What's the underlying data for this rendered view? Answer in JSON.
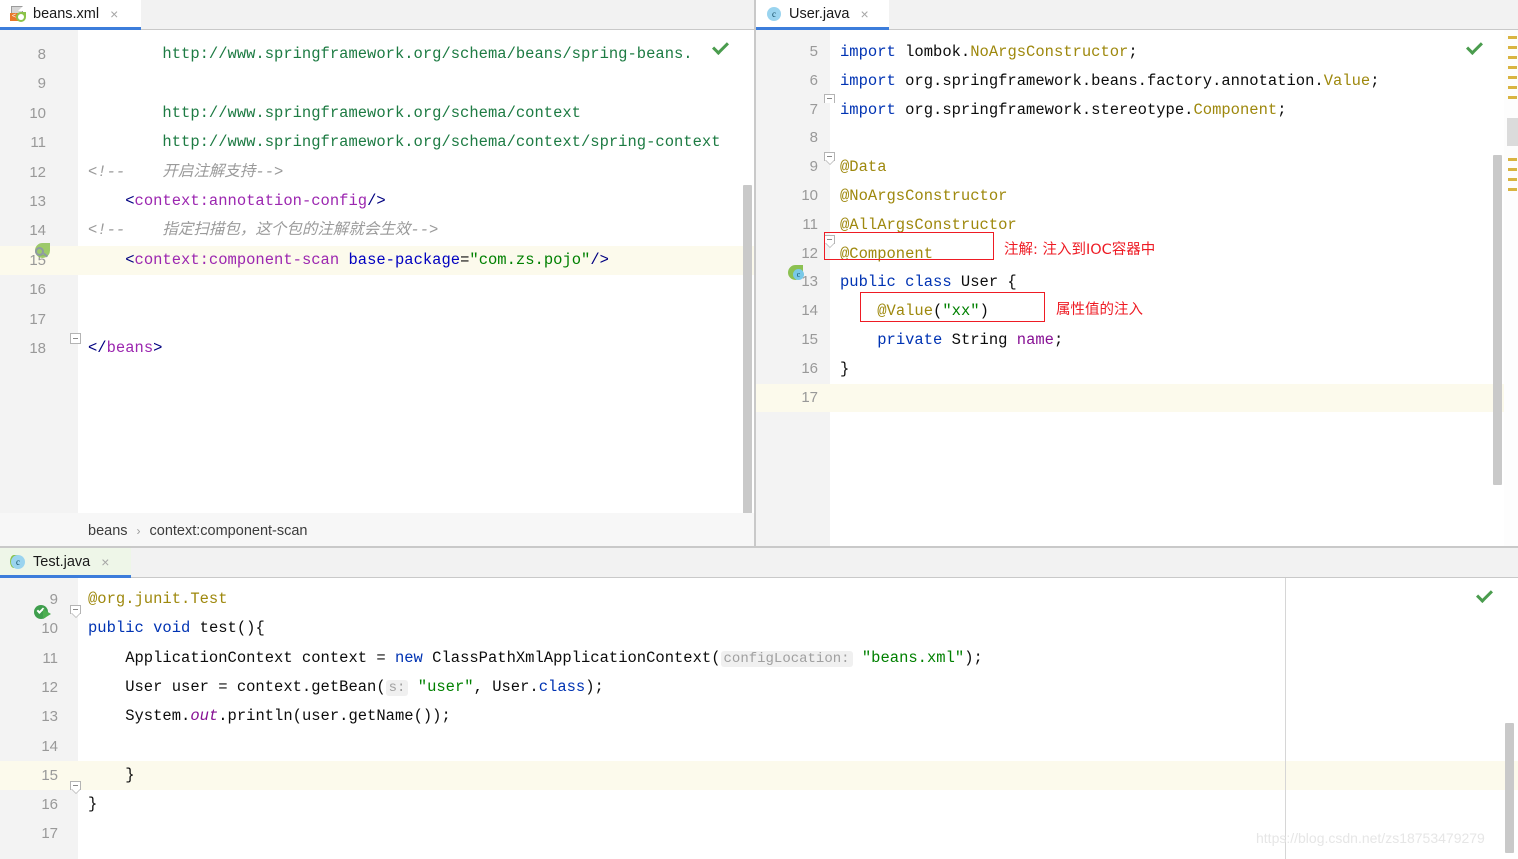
{
  "window": {
    "watermark": "https://blog.csdn.net/zs18753479279"
  },
  "panes": {
    "xml": {
      "tab": {
        "label": "beans.xml",
        "close": "×",
        "icon": "xml-file-icon",
        "icon_letter": "<"
      },
      "breadcrumb": {
        "root": "beans",
        "sep": "›",
        "leaf": "context:component-scan"
      },
      "lines": [
        {
          "num": "8",
          "indent": 0,
          "tokens": [
            {
              "t": "url",
              "v": "        http://www.springframework.org/schema/beans/spring-beans."
            }
          ]
        },
        {
          "num": "9",
          "indent": 0,
          "tokens": []
        },
        {
          "num": "10",
          "indent": 0,
          "tokens": [
            {
              "t": "url",
              "v": "        http://www.springframework.org/schema/context"
            }
          ]
        },
        {
          "num": "11",
          "indent": 0,
          "tokens": [
            {
              "t": "url",
              "v": "        http://www.springframework.org/schema/context/spring-context"
            }
          ]
        },
        {
          "num": "12",
          "indent": 0,
          "tokens": [
            {
              "t": "comment",
              "v": "<!--    开启注解支持-->"
            }
          ]
        },
        {
          "num": "13",
          "indent": 0,
          "tokens": [
            {
              "t": "tag",
              "v": "    <"
            },
            {
              "t": "xmlname",
              "v": "context:annotation-config"
            },
            {
              "t": "tag",
              "v": "/>"
            }
          ]
        },
        {
          "num": "14",
          "indent": 0,
          "tokens": [
            {
              "t": "comment",
              "v": "<!--    指定扫描包，这个包的注解就会生效-->"
            }
          ]
        },
        {
          "num": "15",
          "indent": 0,
          "caret": true,
          "tokens": [
            {
              "t": "tag",
              "v": "    <"
            },
            {
              "t": "xmlname",
              "v": "context:component-scan"
            },
            {
              "t": "plain",
              "v": " "
            },
            {
              "t": "attr",
              "v": "base-package"
            },
            {
              "t": "plain",
              "v": "="
            },
            {
              "t": "str",
              "v": "\"com.zs.pojo\""
            },
            {
              "t": "tag",
              "v": "/>"
            }
          ]
        },
        {
          "num": "16",
          "indent": 0,
          "tokens": []
        },
        {
          "num": "17",
          "indent": 0,
          "tokens": []
        },
        {
          "num": "18",
          "indent": 0,
          "tokens": [
            {
              "t": "tag",
              "v": "</"
            },
            {
              "t": "xmlname",
              "v": "beans"
            },
            {
              "t": "tag",
              "v": ">"
            }
          ]
        }
      ]
    },
    "java_user": {
      "tab": {
        "label": "User.java",
        "close": "×",
        "icon": "java-class-icon",
        "icon_letter": "c"
      },
      "lines": [
        {
          "num": "5",
          "tokens": [
            {
              "t": "kw",
              "v": "import"
            },
            {
              "t": "plain",
              "v": " lombok."
            },
            {
              "t": "anno",
              "v": "NoArgsConstructor"
            },
            {
              "t": "plain",
              "v": ";"
            }
          ]
        },
        {
          "num": "6",
          "tokens": [
            {
              "t": "kw",
              "v": "import"
            },
            {
              "t": "plain",
              "v": " org.springframework.beans.factory.annotation."
            },
            {
              "t": "anno",
              "v": "Value"
            },
            {
              "t": "plain",
              "v": ";"
            }
          ]
        },
        {
          "num": "7",
          "tokens": [
            {
              "t": "kw",
              "v": "import"
            },
            {
              "t": "plain",
              "v": " org.springframework.stereotype."
            },
            {
              "t": "anno",
              "v": "Component"
            },
            {
              "t": "plain",
              "v": ";"
            }
          ]
        },
        {
          "num": "8",
          "tokens": []
        },
        {
          "num": "9",
          "tokens": [
            {
              "t": "anno",
              "v": "@Data"
            }
          ]
        },
        {
          "num": "10",
          "tokens": [
            {
              "t": "anno",
              "v": "@NoArgsConstructor"
            }
          ]
        },
        {
          "num": "11",
          "tokens": [
            {
              "t": "anno",
              "v": "@AllArgsConstructor"
            }
          ]
        },
        {
          "num": "12",
          "tokens": [
            {
              "t": "anno",
              "v": "@Component"
            }
          ]
        },
        {
          "num": "13",
          "tokens": [
            {
              "t": "kw",
              "v": "public class"
            },
            {
              "t": "plain",
              "v": " User {"
            }
          ]
        },
        {
          "num": "14",
          "tokens": [
            {
              "t": "plain",
              "v": "    "
            },
            {
              "t": "anno",
              "v": "@Value"
            },
            {
              "t": "plain",
              "v": "("
            },
            {
              "t": "str",
              "v": "\"xx\""
            },
            {
              "t": "plain",
              "v": ")"
            }
          ]
        },
        {
          "num": "15",
          "tokens": [
            {
              "t": "plain",
              "v": "    "
            },
            {
              "t": "kw",
              "v": "private"
            },
            {
              "t": "plain",
              "v": " String "
            },
            {
              "t": "field",
              "v": "name"
            },
            {
              "t": "plain",
              "v": ";"
            }
          ]
        },
        {
          "num": "16",
          "tokens": [
            {
              "t": "plain",
              "v": "}"
            }
          ]
        },
        {
          "num": "17",
          "caret": true,
          "tokens": []
        }
      ],
      "annotations": [
        {
          "id": "component-note",
          "text": "注解: 注入到IOC容器中"
        },
        {
          "id": "value-note",
          "text": "属性值的注入"
        }
      ]
    },
    "java_test": {
      "tab": {
        "label": "Test.java",
        "close": "×",
        "icon": "java-test-icon",
        "icon_letter": "c"
      },
      "lines": [
        {
          "num": "9",
          "tokens": [
            {
              "t": "anno",
              "v": "@org.junit."
            },
            {
              "t": "anno",
              "v": "Test"
            }
          ]
        },
        {
          "num": "10",
          "tokens": [
            {
              "t": "kw",
              "v": "public void"
            },
            {
              "t": "plain",
              "v": " "
            },
            {
              "t": "plain",
              "v": "test(){"
            }
          ]
        },
        {
          "num": "11",
          "tokens": [
            {
              "t": "plain",
              "v": "    ApplicationContext context = "
            },
            {
              "t": "kw",
              "v": "new"
            },
            {
              "t": "plain",
              "v": " ClassPathXmlApplicationContext("
            },
            {
              "t": "hint",
              "v": "configLocation:"
            },
            {
              "t": "plain",
              "v": " "
            },
            {
              "t": "str",
              "v": "\"beans.xml\""
            },
            {
              "t": "plain",
              "v": ");"
            }
          ]
        },
        {
          "num": "12",
          "tokens": [
            {
              "t": "plain",
              "v": "    User user = context.getBean("
            },
            {
              "t": "hint",
              "v": "s:"
            },
            {
              "t": "plain",
              "v": " "
            },
            {
              "t": "str",
              "v": "\"user\""
            },
            {
              "t": "plain",
              "v": ", User."
            },
            {
              "t": "kw",
              "v": "class"
            },
            {
              "t": "plain",
              "v": ");"
            }
          ]
        },
        {
          "num": "13",
          "tokens": [
            {
              "t": "plain",
              "v": "    System."
            },
            {
              "t": "static",
              "v": "out"
            },
            {
              "t": "plain",
              "v": ".println(user.getName());"
            }
          ]
        },
        {
          "num": "14",
          "tokens": []
        },
        {
          "num": "15",
          "caret": true,
          "tokens": [
            {
              "t": "plain",
              "v": "    }"
            }
          ]
        },
        {
          "num": "16",
          "tokens": [
            {
              "t": "plain",
              "v": "}"
            }
          ]
        },
        {
          "num": "17",
          "tokens": []
        }
      ]
    }
  },
  "colors": {
    "accent_blue": "#3c7ddb",
    "annotation_red": "#ee1b24",
    "string_green": "#008000",
    "keyword_blue": "#0033b3",
    "annotation_gold": "#9e880d",
    "caret_line": "#fcfaec",
    "gutter_bg": "#f3f3f3"
  }
}
